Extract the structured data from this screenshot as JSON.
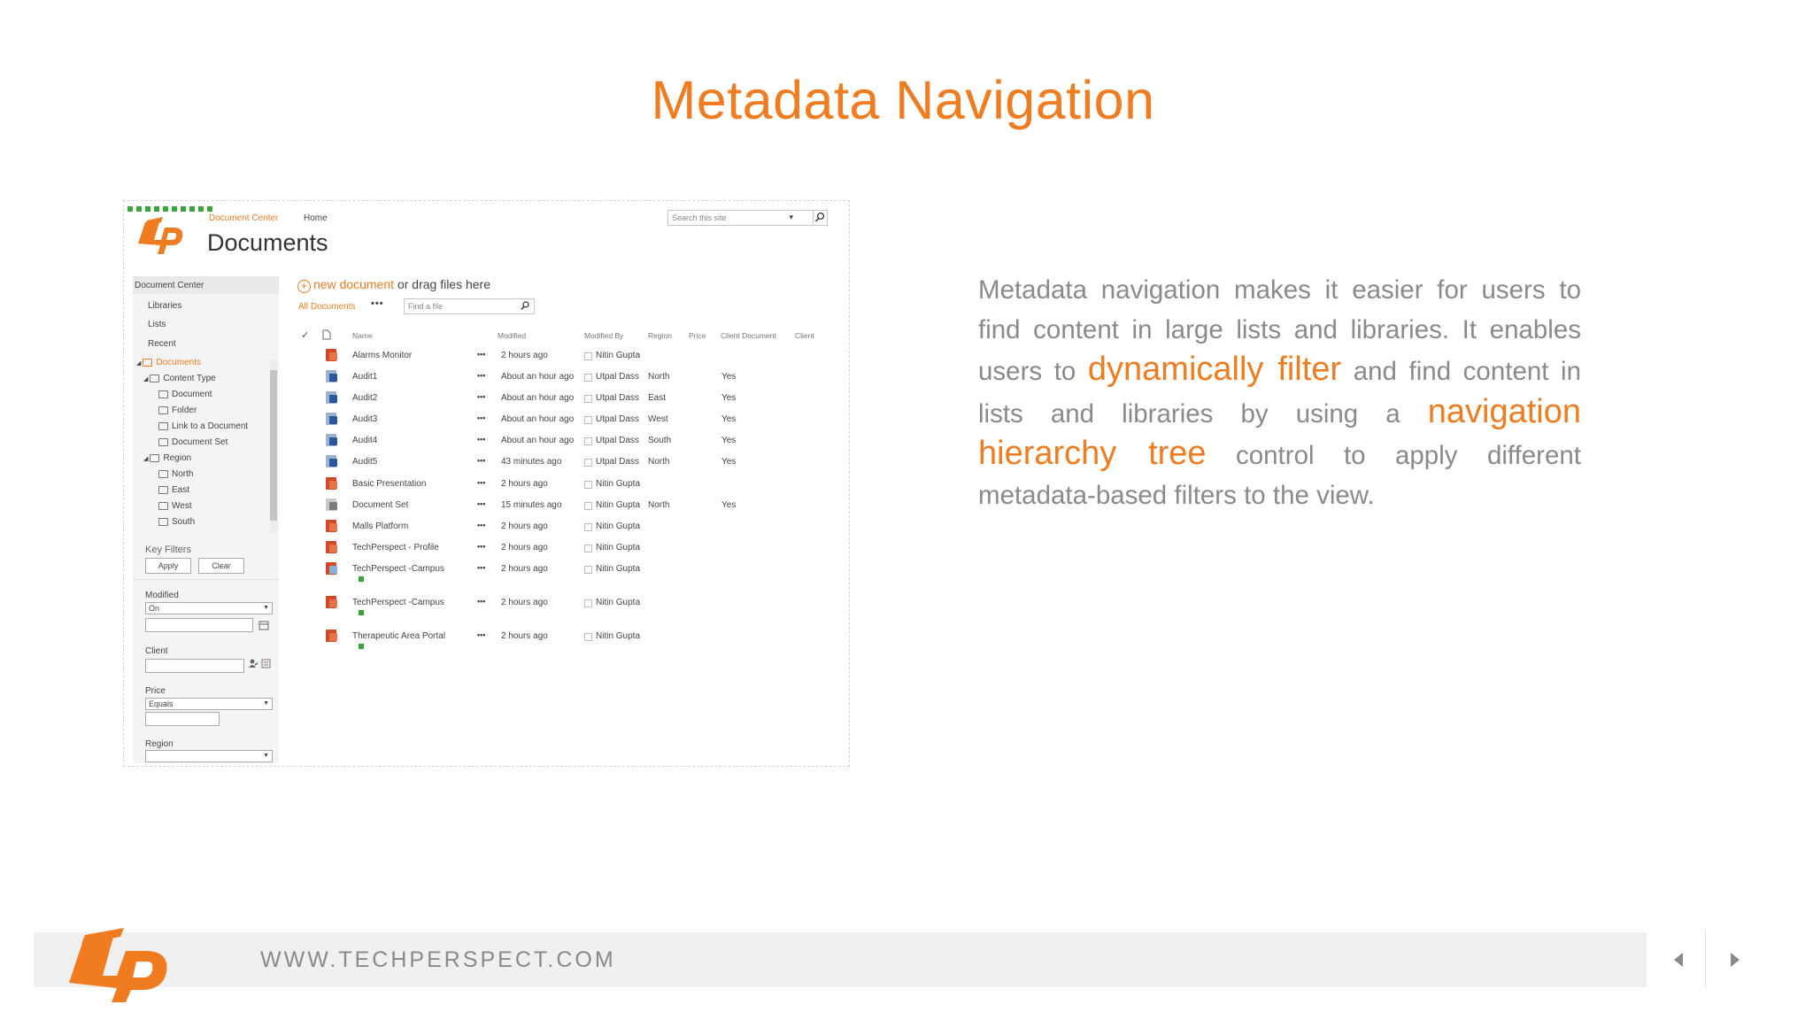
{
  "slide": {
    "title": "Metadata Navigation"
  },
  "screenshot": {
    "breadcrumb": {
      "site": "Document Center",
      "home": "Home"
    },
    "title": "Documents",
    "site_search": {
      "placeholder": "Search this site"
    },
    "left_nav": {
      "header": "Document Center",
      "links": [
        "Libraries",
        "Lists",
        "Recent"
      ],
      "tree": {
        "library": "Documents",
        "content_type": "Content Type",
        "content_types": [
          "Document",
          "Folder",
          "Link to a Document",
          "Document Set"
        ],
        "region": "Region",
        "regions": [
          "North",
          "East",
          "West",
          "South"
        ]
      },
      "key_filters": {
        "title": "Key Filters",
        "apply_label": "Apply",
        "clear_label": "Clear",
        "modified_label": "Modified",
        "modified_operator": "On",
        "client_label": "Client",
        "price_label": "Price",
        "price_operator": "Equals",
        "region_label": "Region"
      }
    },
    "toolbar": {
      "new_document": "new document",
      "drag_text": "or drag files here",
      "view_name": "All Documents",
      "more": "•••",
      "find_placeholder": "Find a file"
    },
    "columns": [
      "Name",
      "Modified",
      "Modified By",
      "Region",
      "Price",
      "Client Document",
      "Client"
    ],
    "rows": [
      {
        "name": "Alarms Monitor",
        "name2": "",
        "modified": "2 hours ago",
        "modified_by": "Nitin Gupta",
        "region": "",
        "client_document": "",
        "icon": "ppt"
      },
      {
        "name": "Audit1",
        "name2": "",
        "modified": "About an hour ago",
        "modified_by": "Utpal Dass",
        "region": "North",
        "client_document": "Yes",
        "icon": "word"
      },
      {
        "name": "Audit2",
        "name2": "",
        "modified": "About an hour ago",
        "modified_by": "Utpal Dass",
        "region": "East",
        "client_document": "Yes",
        "icon": "word"
      },
      {
        "name": "Audit3",
        "name2": "",
        "modified": "About an hour ago",
        "modified_by": "Utpal Dass",
        "region": "West",
        "client_document": "Yes",
        "icon": "word"
      },
      {
        "name": "Audit4",
        "name2": "",
        "modified": "About an hour ago",
        "modified_by": "Utpal Dass",
        "region": "South",
        "client_document": "Yes",
        "icon": "word"
      },
      {
        "name": "Audit5",
        "name2": "",
        "modified": "43 minutes ago",
        "modified_by": "Utpal Dass",
        "region": "North",
        "client_document": "Yes",
        "icon": "word"
      },
      {
        "name": "Basic Presentation",
        "name2": "",
        "modified": "2 hours ago",
        "modified_by": "Nitin Gupta",
        "region": "",
        "client_document": "",
        "icon": "ppt"
      },
      {
        "name": "Document Set",
        "name2": "",
        "modified": "15 minutes ago",
        "modified_by": "Nitin Gupta",
        "region": "North",
        "client_document": "Yes",
        "icon": "docset"
      },
      {
        "name": "Malls Platform",
        "name2": "",
        "modified": "2 hours ago",
        "modified_by": "Nitin Gupta",
        "region": "",
        "client_document": "",
        "icon": "ppt"
      },
      {
        "name": "TechPerspect - Profile",
        "name2": "",
        "modified": "2 hours ago",
        "modified_by": "Nitin Gupta",
        "region": "",
        "client_document": "",
        "icon": "ppt"
      },
      {
        "name": "TechPerspect -Campus",
        "name2": "",
        "modified": "2 hours ago",
        "modified_by": "Nitin Gupta",
        "region": "",
        "client_document": "",
        "icon": "image"
      },
      {
        "name": "TechPerspect -Campus",
        "name2": "",
        "modified": "2 hours ago",
        "modified_by": "Nitin Gupta",
        "region": "",
        "client_document": "",
        "icon": "ppt"
      },
      {
        "name": "Therapeutic Area Portal",
        "name2": "",
        "modified": "2 hours ago",
        "modified_by": "Nitin Gupta",
        "region": "",
        "client_document": "",
        "icon": "ppt"
      }
    ]
  },
  "paragraph": {
    "p1": "Metadata navigation makes it easier for users to find content in large lists and libraries. It enables users to ",
    "h1": "dynamically filter",
    "p2": " and find content in lists and libraries by using a ",
    "h2": "navigation hierarchy tree",
    "p3": " control to apply different metadata-based filters to the view."
  },
  "footer": {
    "url": "WWW.TECHPERSPECT.COM"
  },
  "colors": {
    "accent": "#f07c1f",
    "body_text": "#8a8a8a",
    "footer_bar": "#f0f0f0"
  },
  "icons": [
    "tp-logo",
    "search-icon",
    "plus-circle-icon",
    "calendar-icon",
    "people-picker-icon",
    "prev-slide-icon",
    "next-slide-icon"
  ]
}
